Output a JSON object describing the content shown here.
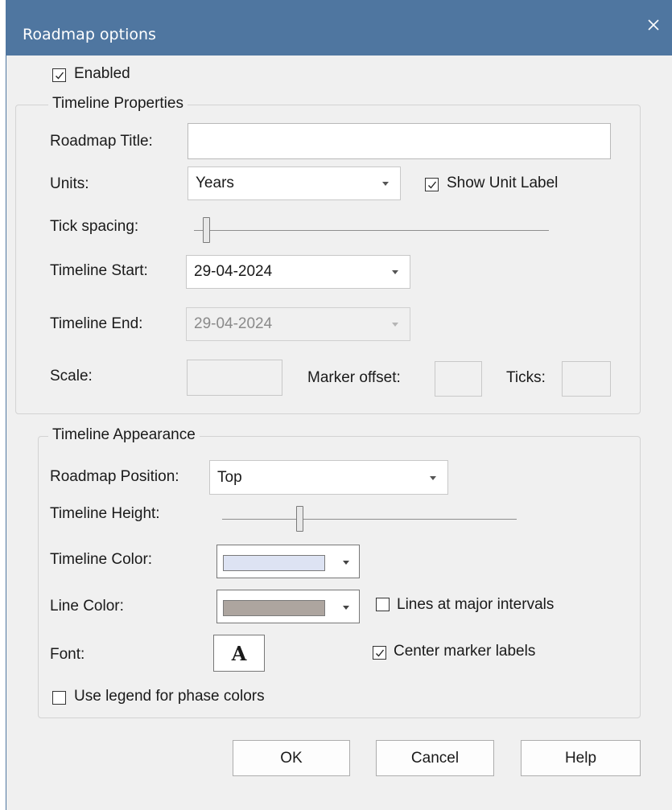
{
  "window": {
    "title": "Roadmap options"
  },
  "enabled": {
    "label": "Enabled",
    "checked": true
  },
  "timeline_properties": {
    "group_label": "Timeline Properties",
    "roadmap_title": {
      "label": "Roadmap Title:",
      "value": ""
    },
    "units": {
      "label": "Units:",
      "value": "Years"
    },
    "show_unit_label": {
      "label": "Show Unit Label",
      "checked": true
    },
    "tick_spacing": {
      "label": "Tick spacing:"
    },
    "timeline_start": {
      "label": "Timeline Start:",
      "value": "29-04-2024"
    },
    "timeline_end": {
      "label": "Timeline End:",
      "value": "29-04-2024"
    },
    "scale": {
      "label": "Scale:",
      "value": ""
    },
    "marker_offset": {
      "label": "Marker offset:",
      "value": ""
    },
    "ticks": {
      "label": "Ticks:",
      "value": ""
    }
  },
  "timeline_appearance": {
    "group_label": "Timeline Appearance",
    "roadmap_position": {
      "label": "Roadmap Position:",
      "value": "Top"
    },
    "timeline_height": {
      "label": "Timeline Height:"
    },
    "timeline_color": {
      "label": "Timeline Color:",
      "color": "#dde3f3"
    },
    "line_color": {
      "label": "Line Color:",
      "color": "#ada59f"
    },
    "lines_at_major_intervals": {
      "label": "Lines at major intervals",
      "checked": false
    },
    "font": {
      "label": "Font:",
      "glyph": "A"
    },
    "center_marker_labels": {
      "label": "Center marker labels",
      "checked": true
    },
    "use_legend": {
      "label": "Use legend for phase colors",
      "checked": false
    }
  },
  "buttons": {
    "ok": "OK",
    "cancel": "Cancel",
    "help": "Help"
  },
  "colors": {
    "titlebar": "#4f76a0",
    "dialog_bg": "#f0f0f0"
  }
}
